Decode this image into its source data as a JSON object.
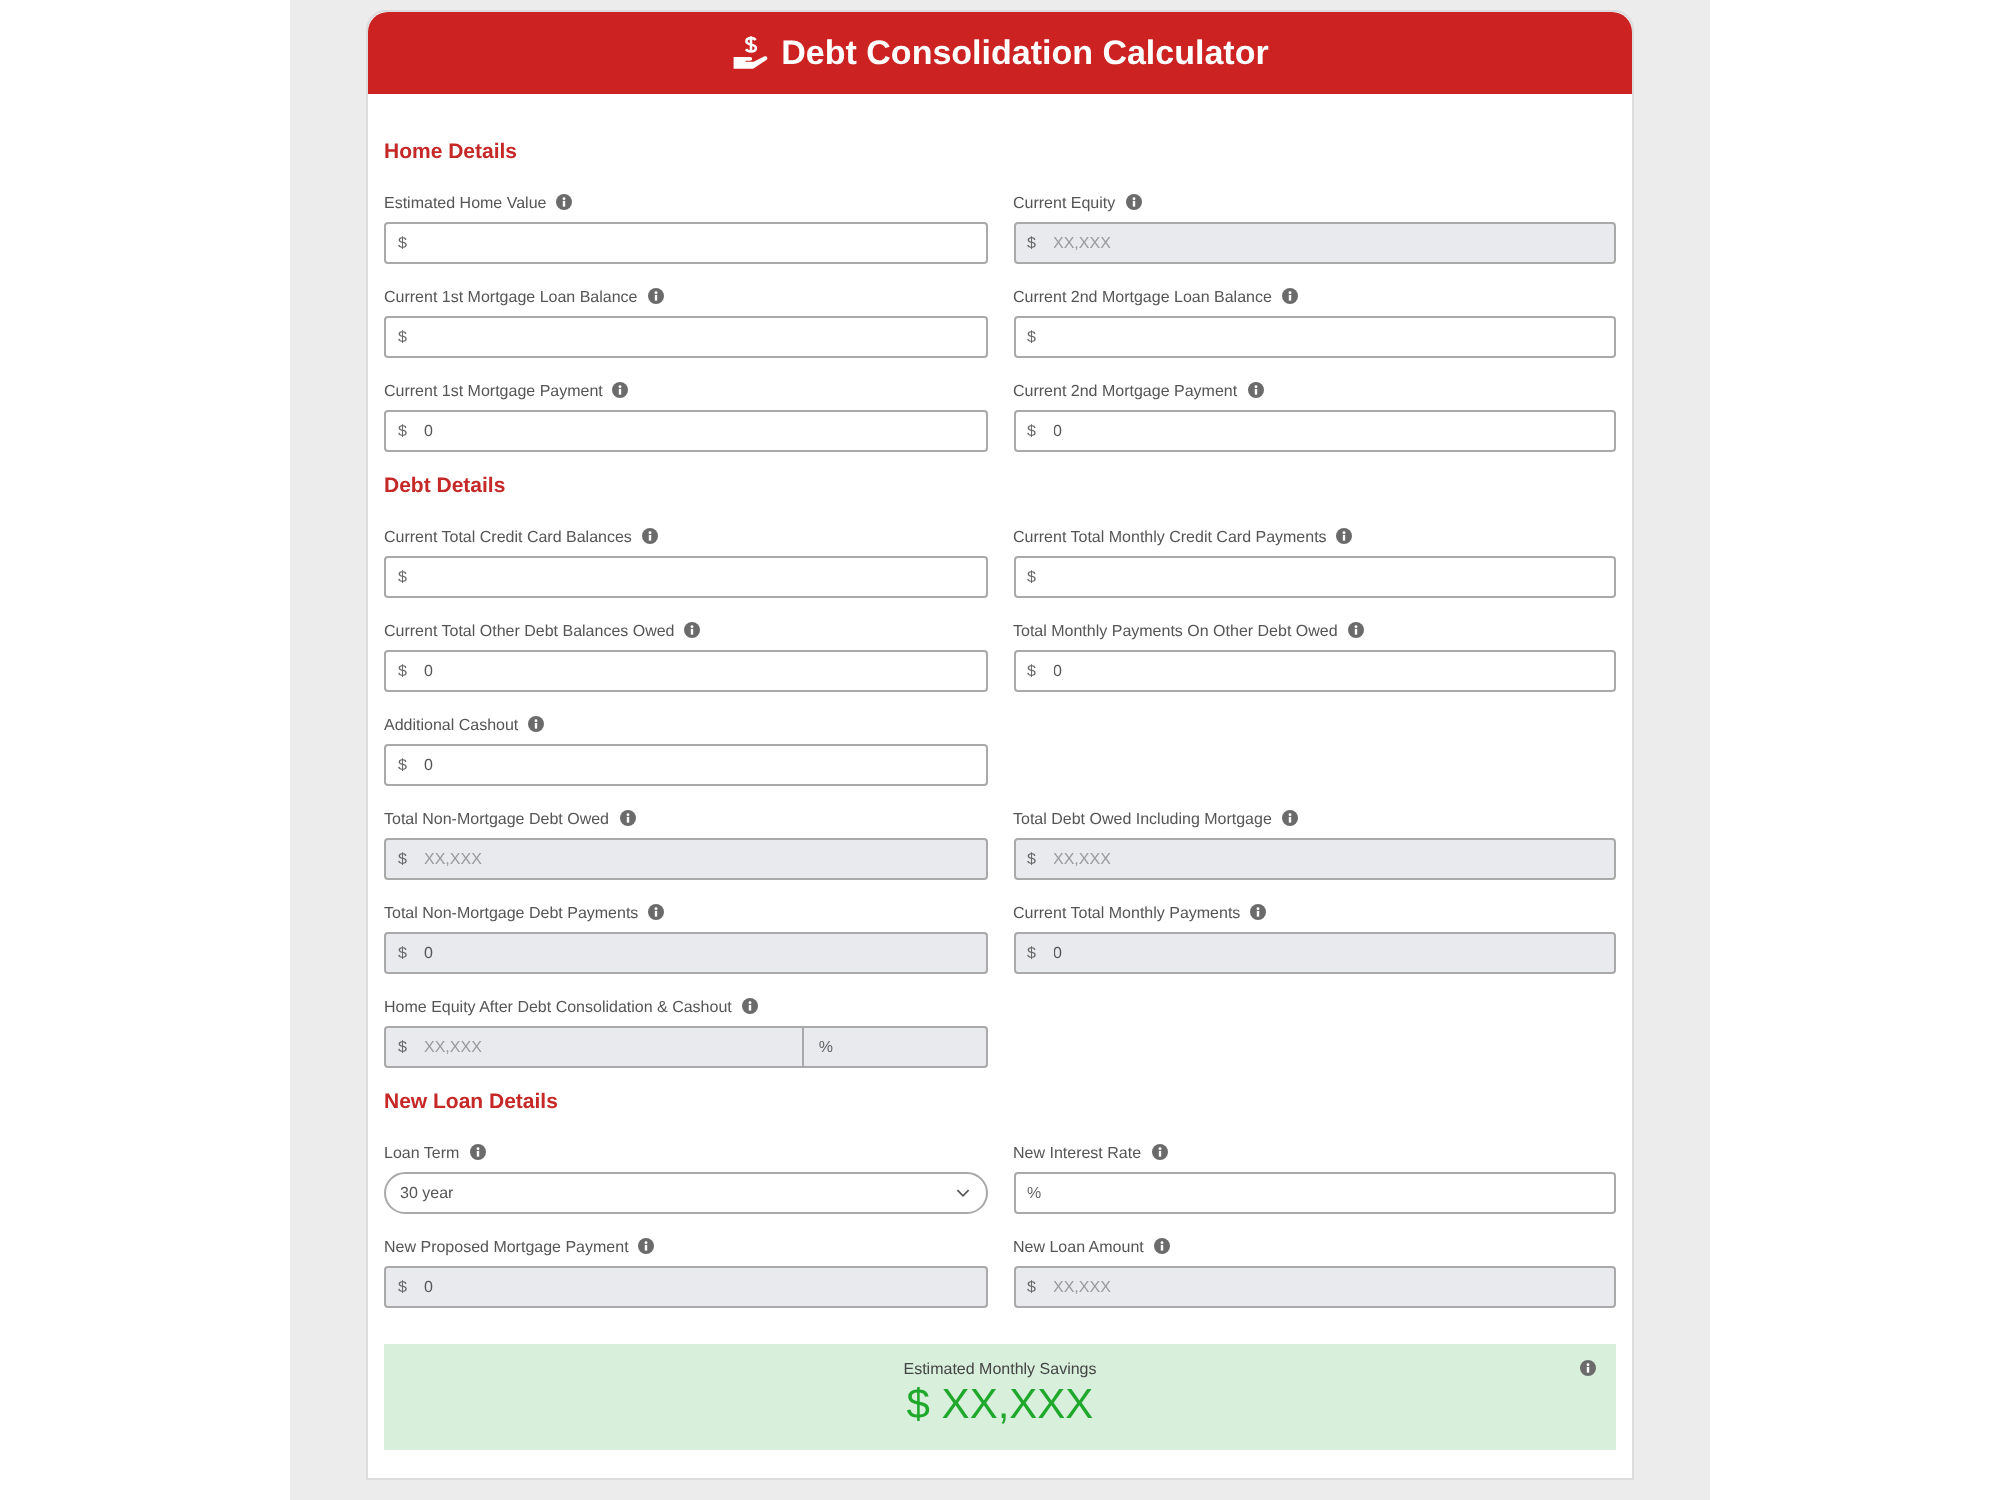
{
  "header": {
    "title": "Debt Consolidation Calculator"
  },
  "sections": [
    {
      "title": "Home Details",
      "rows": [
        [
          {
            "kind": "input",
            "label": "Estimated Home Value",
            "prefix": "$",
            "disabled": false
          },
          {
            "kind": "input",
            "label": "Current Equity",
            "prefix": "$",
            "placeholder": "XX,XXX",
            "disabled": true
          }
        ],
        [
          {
            "kind": "input",
            "label": "Current 1st Mortgage Loan Balance",
            "prefix": "$",
            "disabled": false
          },
          {
            "kind": "input",
            "label": "Current 2nd Mortgage Loan Balance",
            "prefix": "$",
            "disabled": false
          }
        ],
        [
          {
            "kind": "input",
            "label": "Current 1st Mortgage Payment",
            "prefix": "$",
            "value": "0",
            "disabled": false
          },
          {
            "kind": "input",
            "label": "Current 2nd Mortgage Payment",
            "prefix": "$",
            "value": "0",
            "disabled": false
          }
        ]
      ]
    },
    {
      "title": "Debt Details",
      "rows": [
        [
          {
            "kind": "input",
            "label": "Current Total Credit Card Balances",
            "prefix": "$",
            "disabled": false
          },
          {
            "kind": "input",
            "label": "Current Total Monthly Credit Card Payments",
            "prefix": "$",
            "disabled": false
          }
        ],
        [
          {
            "kind": "input",
            "label": "Current Total Other Debt Balances Owed",
            "prefix": "$",
            "value": "0",
            "disabled": false
          },
          {
            "kind": "input",
            "label": "Total Monthly Payments On Other Debt Owed",
            "prefix": "$",
            "value": "0",
            "disabled": false
          }
        ],
        [
          {
            "kind": "input",
            "label": "Additional Cashout",
            "prefix": "$",
            "value": "0",
            "disabled": false
          }
        ],
        [
          {
            "kind": "input",
            "label": "Total Non-Mortgage Debt Owed",
            "prefix": "$",
            "placeholder": "XX,XXX",
            "disabled": true
          },
          {
            "kind": "input",
            "label": "Total Debt Owed Including Mortgage",
            "prefix": "$",
            "placeholder": "XX,XXX",
            "disabled": true
          }
        ],
        [
          {
            "kind": "input",
            "label": "Total Non-Mortgage Debt Payments",
            "prefix": "$",
            "value": "0",
            "disabled": true
          },
          {
            "kind": "input",
            "label": "Current Total Monthly Payments",
            "prefix": "$",
            "value": "0",
            "disabled": true
          }
        ],
        [
          {
            "kind": "split",
            "label": "Home Equity After Debt Consolidation & Cashout",
            "disabled": true,
            "parts": [
              {
                "prefix": "$",
                "placeholder": "XX,XXX"
              },
              {
                "prefix": "%"
              }
            ]
          }
        ]
      ]
    },
    {
      "title": "New Loan Details",
      "rows": [
        [
          {
            "kind": "select",
            "label": "Loan Term",
            "value": "30 year",
            "disabled": false
          },
          {
            "kind": "input",
            "label": "New Interest Rate",
            "prefix": "%",
            "disabled": false
          }
        ],
        [
          {
            "kind": "input",
            "label": "New Proposed Mortgage Payment",
            "prefix": "$",
            "value": "0",
            "disabled": true
          },
          {
            "kind": "input",
            "label": "New Loan Amount",
            "prefix": "$",
            "placeholder": "XX,XXX",
            "disabled": true
          }
        ]
      ]
    }
  ],
  "result": {
    "label": "Estimated Monthly Savings",
    "value": "$ XX,XXX"
  }
}
